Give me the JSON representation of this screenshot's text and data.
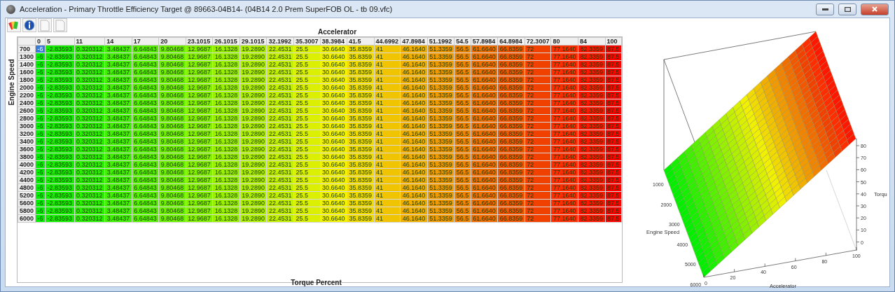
{
  "window": {
    "title": "Acceleration - Primary Throttle Efficiency Target @ 89663-04B14- (04B14 2.0 Prem SuperFOB OL - tb 09.vfc)"
  },
  "toolbar": [
    {
      "kind": "palette"
    },
    {
      "kind": "info"
    },
    {
      "kind": "page"
    },
    {
      "kind": "page"
    }
  ],
  "table": {
    "title": "Accelerator",
    "row_axis": "Engine Speed",
    "footer": "Torque Percent",
    "columns": [
      "0",
      "5",
      "11",
      "14",
      "17",
      "20",
      "23.1015",
      "26.1015",
      "29.1015",
      "32.1992",
      "35.3007",
      "38.3984",
      "41.5",
      "44.6992",
      "47.8984",
      "51.1992",
      "54.5",
      "57.8984",
      "64.8984",
      "72.3007",
      "80",
      "84",
      "100"
    ],
    "rows": [
      {
        "speed": "700",
        "first_cell_selected": true,
        "cells": [
          "-6",
          "-2.83593",
          "0.320312",
          "3.48437",
          "6.64843",
          "9.80468",
          "12.9687",
          "16.1328",
          "19.2890",
          "22.4531",
          "25.5",
          "30.6640",
          "35.8359",
          "41",
          "46.1640",
          "51.3359",
          "56.5",
          "61.6640",
          "66.8359",
          "72",
          "77.1640",
          "82.3359",
          "87.5"
        ]
      },
      {
        "speed": "1300",
        "first_cell_selected": false,
        "cells": [
          "-6",
          "-2.83593",
          "0.320312",
          "3.48437",
          "6.64843",
          "9.80468",
          "12.9687",
          "16.1328",
          "19.2890",
          "22.4531",
          "25.5",
          "30.6640",
          "35.8359",
          "41",
          "46.1640",
          "51.3359",
          "56.5",
          "61.6640",
          "66.8359",
          "72",
          "77.1640",
          "82.3359",
          "87.5"
        ]
      },
      {
        "speed": "1400",
        "first_cell_selected": false,
        "cells": [
          "-6",
          "-2.83593",
          "0.320312",
          "3.48437",
          "6.64843",
          "9.80468",
          "12.9687",
          "16.1328",
          "19.2890",
          "22.4531",
          "25.5",
          "30.6640",
          "35.8359",
          "41",
          "46.1640",
          "51.3359",
          "56.5",
          "61.6640",
          "66.8359",
          "72",
          "77.1640",
          "82.3359",
          "87.5"
        ]
      },
      {
        "speed": "1600",
        "first_cell_selected": false,
        "cells": [
          "-6",
          "-2.83593",
          "0.320312",
          "3.48437",
          "6.64843",
          "9.80468",
          "12.9687",
          "16.1328",
          "19.2890",
          "22.4531",
          "25.5",
          "30.6640",
          "35.8359",
          "41",
          "46.1640",
          "51.3359",
          "56.5",
          "61.6640",
          "66.8359",
          "72",
          "77.1640",
          "82.3359",
          "87.5"
        ]
      },
      {
        "speed": "1800",
        "first_cell_selected": false,
        "cells": [
          "-6",
          "-2.83593",
          "0.320312",
          "3.48437",
          "6.64843",
          "9.80468",
          "12.9687",
          "16.1328",
          "19.2890",
          "22.4531",
          "25.5",
          "30.6640",
          "35.8359",
          "41",
          "46.1640",
          "51.3359",
          "56.5",
          "61.6640",
          "66.8359",
          "72",
          "77.1640",
          "82.3359",
          "87.5"
        ]
      },
      {
        "speed": "2000",
        "first_cell_selected": false,
        "cells": [
          "-6",
          "-2.83593",
          "0.320312",
          "3.48437",
          "6.64843",
          "9.80468",
          "12.9687",
          "16.1328",
          "19.2890",
          "22.4531",
          "25.5",
          "30.6640",
          "35.8359",
          "41",
          "46.1640",
          "51.3359",
          "56.5",
          "61.6640",
          "66.8359",
          "72",
          "77.1640",
          "82.3359",
          "87.5"
        ]
      },
      {
        "speed": "2200",
        "first_cell_selected": false,
        "cells": [
          "-6",
          "-2.83593",
          "0.320312",
          "3.48437",
          "6.64843",
          "9.80468",
          "12.9687",
          "16.1328",
          "19.2890",
          "22.4531",
          "25.5",
          "30.6640",
          "35.8359",
          "41",
          "46.1640",
          "51.3359",
          "56.5",
          "61.6640",
          "66.8359",
          "72",
          "77.1640",
          "82.3359",
          "87.5"
        ]
      },
      {
        "speed": "2400",
        "first_cell_selected": false,
        "cells": [
          "-6",
          "-2.83593",
          "0.320312",
          "3.48437",
          "6.64843",
          "9.80468",
          "12.9687",
          "16.1328",
          "19.2890",
          "22.4531",
          "25.5",
          "30.6640",
          "35.8359",
          "41",
          "46.1640",
          "51.3359",
          "56.5",
          "61.6640",
          "66.8359",
          "72",
          "77.1640",
          "82.3359",
          "87.5"
        ]
      },
      {
        "speed": "2600",
        "first_cell_selected": false,
        "cells": [
          "-6",
          "-2.83593",
          "0.320312",
          "3.48437",
          "6.64843",
          "9.80468",
          "12.9687",
          "16.1328",
          "19.2890",
          "22.4531",
          "25.5",
          "30.6640",
          "35.8359",
          "41",
          "46.1640",
          "51.3359",
          "56.5",
          "61.6640",
          "66.8359",
          "72",
          "77.1640",
          "82.3359",
          "87.5"
        ]
      },
      {
        "speed": "2800",
        "first_cell_selected": false,
        "cells": [
          "-6",
          "-2.83593",
          "0.320312",
          "3.48437",
          "6.64843",
          "9.80468",
          "12.9687",
          "16.1328",
          "19.2890",
          "22.4531",
          "25.5",
          "30.6640",
          "35.8359",
          "41",
          "46.1640",
          "51.3359",
          "56.5",
          "61.6640",
          "66.8359",
          "72",
          "77.1640",
          "82.3359",
          "87.5"
        ]
      },
      {
        "speed": "3000",
        "first_cell_selected": false,
        "cells": [
          "-6",
          "-2.83593",
          "0.320312",
          "3.48437",
          "6.64843",
          "9.80468",
          "12.9687",
          "16.1328",
          "19.2890",
          "22.4531",
          "25.5",
          "30.6640",
          "35.8359",
          "41",
          "46.1640",
          "51.3359",
          "56.5",
          "61.6640",
          "66.8359",
          "72",
          "77.1640",
          "82.3359",
          "87.5"
        ]
      },
      {
        "speed": "3200",
        "first_cell_selected": false,
        "cells": [
          "-6",
          "-2.83593",
          "0.320312",
          "3.48437",
          "6.64843",
          "9.80468",
          "12.9687",
          "16.1328",
          "19.2890",
          "22.4531",
          "25.5",
          "30.6640",
          "35.8359",
          "41",
          "46.1640",
          "51.3359",
          "56.5",
          "61.6640",
          "66.8359",
          "72",
          "77.1640",
          "82.3359",
          "87.5"
        ]
      },
      {
        "speed": "3400",
        "first_cell_selected": false,
        "cells": [
          "-6",
          "-2.83593",
          "0.320312",
          "3.48437",
          "6.64843",
          "9.80468",
          "12.9687",
          "16.1328",
          "19.2890",
          "22.4531",
          "25.5",
          "30.6640",
          "35.8359",
          "41",
          "46.1640",
          "51.3359",
          "56.5",
          "61.6640",
          "66.8359",
          "72",
          "77.1640",
          "82.3359",
          "87.5"
        ]
      },
      {
        "speed": "3600",
        "first_cell_selected": false,
        "cells": [
          "-6",
          "-2.83593",
          "0.320312",
          "3.48437",
          "6.64843",
          "9.80468",
          "12.9687",
          "16.1328",
          "19.2890",
          "22.4531",
          "25.5",
          "30.6640",
          "35.8359",
          "41",
          "46.1640",
          "51.3359",
          "56.5",
          "61.6640",
          "66.8359",
          "72",
          "77.1640",
          "82.3359",
          "87.5"
        ]
      },
      {
        "speed": "3800",
        "first_cell_selected": false,
        "cells": [
          "-6",
          "-2.83593",
          "0.320312",
          "3.48437",
          "6.64843",
          "9.80468",
          "12.9687",
          "16.1328",
          "19.2890",
          "22.4531",
          "25.5",
          "30.6640",
          "35.8359",
          "41",
          "46.1640",
          "51.3359",
          "56.5",
          "61.6640",
          "66.8359",
          "72",
          "77.1640",
          "82.3359",
          "87.5"
        ]
      },
      {
        "speed": "4000",
        "first_cell_selected": false,
        "cells": [
          "-6",
          "-2.83593",
          "0.320312",
          "3.48437",
          "6.64843",
          "9.80468",
          "12.9687",
          "16.1328",
          "19.2890",
          "22.4531",
          "25.5",
          "30.6640",
          "35.8359",
          "41",
          "46.1640",
          "51.3359",
          "56.5",
          "61.6640",
          "66.8359",
          "72",
          "77.1640",
          "82.3359",
          "87.5"
        ]
      },
      {
        "speed": "4200",
        "first_cell_selected": false,
        "cells": [
          "-6",
          "-2.83593",
          "0.320312",
          "3.48437",
          "6.64843",
          "9.80468",
          "12.9687",
          "16.1328",
          "19.2890",
          "22.4531",
          "25.5",
          "30.6640",
          "35.8359",
          "41",
          "46.1640",
          "51.3359",
          "56.5",
          "61.6640",
          "66.8359",
          "72",
          "77.1640",
          "82.3359",
          "87.5"
        ]
      },
      {
        "speed": "4400",
        "first_cell_selected": false,
        "cells": [
          "-6",
          "-2.83593",
          "0.320312",
          "3.48437",
          "6.64843",
          "9.80468",
          "12.9687",
          "16.1328",
          "19.2890",
          "22.4531",
          "25.5",
          "30.6640",
          "35.8359",
          "41",
          "46.1640",
          "51.3359",
          "56.5",
          "61.6640",
          "66.8359",
          "72",
          "77.1640",
          "82.3359",
          "87.5"
        ]
      },
      {
        "speed": "4800",
        "first_cell_selected": false,
        "cells": [
          "-6",
          "-2.83593",
          "0.320312",
          "3.48437",
          "6.64843",
          "9.80468",
          "12.9687",
          "16.1328",
          "19.2890",
          "22.4531",
          "25.5",
          "30.6640",
          "35.8359",
          "41",
          "46.1640",
          "51.3359",
          "56.5",
          "61.6640",
          "66.8359",
          "72",
          "77.1640",
          "82.3359",
          "87.5"
        ]
      },
      {
        "speed": "5200",
        "first_cell_selected": false,
        "cells": [
          "-6",
          "-2.83593",
          "0.320312",
          "3.48437",
          "6.64843",
          "9.80468",
          "12.9687",
          "16.1328",
          "19.2890",
          "22.4531",
          "25.5",
          "30.6640",
          "35.8359",
          "41",
          "46.1640",
          "51.3359",
          "56.5",
          "61.6640",
          "66.8359",
          "72",
          "77.1640",
          "82.3359",
          "87.5"
        ]
      },
      {
        "speed": "5600",
        "first_cell_selected": false,
        "cells": [
          "-6",
          "-2.83593",
          "0.320312",
          "3.48437",
          "6.64843",
          "9.80468",
          "12.9687",
          "16.1328",
          "19.2890",
          "22.4531",
          "25.5",
          "30.6640",
          "35.8359",
          "41",
          "46.1640",
          "51.3359",
          "56.5",
          "61.6640",
          "66.8359",
          "72",
          "77.1640",
          "82.3359",
          "87.5"
        ]
      },
      {
        "speed": "5800",
        "first_cell_selected": false,
        "cells": [
          "-6",
          "-2.83593",
          "0.320312",
          "3.48437",
          "6.64843",
          "9.80468",
          "12.9687",
          "16.1328",
          "19.2890",
          "22.4531",
          "25.5",
          "30.6640",
          "35.8359",
          "41",
          "46.1640",
          "51.3359",
          "56.5",
          "61.6640",
          "66.8359",
          "72",
          "77.1640",
          "82.3359",
          "87.5"
        ]
      },
      {
        "speed": "6000",
        "first_cell_selected": false,
        "cells": [
          "-6",
          "-2.83593",
          "0.320312",
          "3.48437",
          "6.64843",
          "9.80468",
          "12.9687",
          "16.1328",
          "19.2890",
          "22.4531",
          "25.5",
          "30.6640",
          "35.8359",
          "41",
          "46.1640",
          "51.3359",
          "56.5",
          "61.6640",
          "66.8359",
          "72",
          "77.1640",
          "82.3359",
          "87.5"
        ]
      }
    ]
  },
  "plot3d": {
    "speed_label": "Engine Speed",
    "accel_label": "Accelerator",
    "torque_label": "Torqu",
    "speed_ticks": [
      "1000",
      "2000",
      "3000",
      "4000",
      "5000",
      "6000"
    ],
    "accel_ticks": [
      "0",
      "20",
      "40",
      "60",
      "80",
      "100"
    ],
    "torque_ticks": [
      "80",
      "70",
      "60",
      "50",
      "40",
      "30",
      "20",
      "10",
      "0"
    ]
  }
}
